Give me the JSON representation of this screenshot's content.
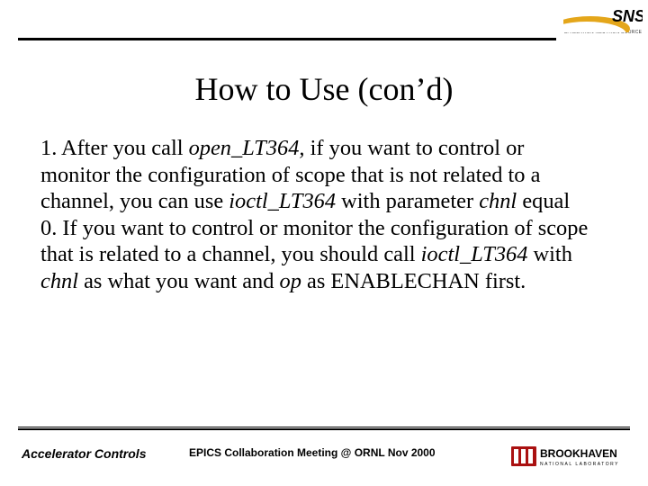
{
  "logo_top": {
    "acronym_path_hint": "SNS",
    "tagline": "SPALLATION NEUTRON SOURCE"
  },
  "title": "How to Use (con’d)",
  "body": {
    "p1_a": "1. After you call ",
    "p1_fn1": "open_LT364,",
    "p1_b": " if you want to control or monitor the configuration of scope that is not related to a channel, you can use ",
    "p1_fn2": "ioctl_LT364",
    "p1_c": " with parameter ",
    "p1_var1": "chnl",
    "p1_d": " equal 0. If you want to control or monitor the configuration of scope that is related to a channel, you should call ",
    "p1_fn3": "ioctl_LT364",
    "p1_e": " with ",
    "p1_var2": "chnl",
    "p1_f": " as what you want and ",
    "p1_var3": "op",
    "p1_g": " as ENABLECHAN first."
  },
  "footer": {
    "left": "Accelerator Controls",
    "center": "EPICS Collaboration Meeting @ ORNL Nov 2000",
    "logo_name": "BROOKHAVEN",
    "logo_sub": "N A T I O N A L   L A B O R A T O R Y"
  }
}
